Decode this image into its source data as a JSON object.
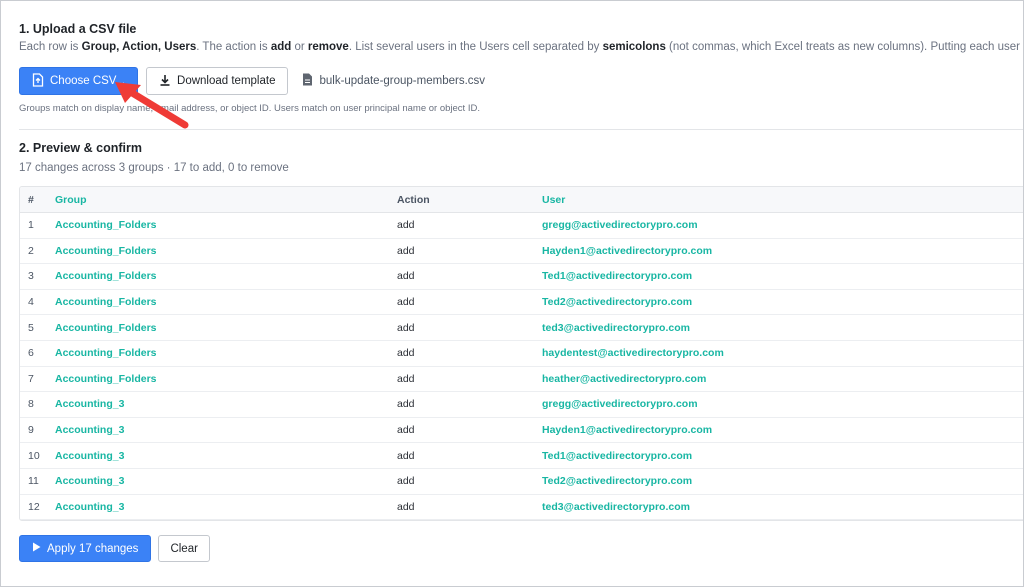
{
  "upload": {
    "title": "1. Upload a CSV file",
    "desc_parts": [
      "Each row is ",
      "Group, Action, Users",
      ". The action is ",
      "add",
      " or ",
      "remove",
      ". List several users in the Users cell separated by ",
      "semicolons",
      " (not commas, which Excel treats as new columns). Putting each user in its own c"
    ],
    "choose_label": "Choose CSV...",
    "template_label": "Download template",
    "file_name": "bulk-update-group-members.csv",
    "hint": "Groups match on display name, email address, or object ID. Users match on user principal name or object ID."
  },
  "preview": {
    "title": "2. Preview & confirm",
    "summary": "17 changes across 3 groups · 17 to add, 0 to remove",
    "columns": [
      "#",
      "Group",
      "Action",
      "User"
    ],
    "rows": [
      {
        "num": "1",
        "group": "Accounting_Folders",
        "action": "add",
        "user": "gregg@activedirectorypro.com"
      },
      {
        "num": "2",
        "group": "Accounting_Folders",
        "action": "add",
        "user": "Hayden1@activedirectorypro.com"
      },
      {
        "num": "3",
        "group": "Accounting_Folders",
        "action": "add",
        "user": "Ted1@activedirectorypro.com"
      },
      {
        "num": "4",
        "group": "Accounting_Folders",
        "action": "add",
        "user": "Ted2@activedirectorypro.com"
      },
      {
        "num": "5",
        "group": "Accounting_Folders",
        "action": "add",
        "user": "ted3@activedirectorypro.com"
      },
      {
        "num": "6",
        "group": "Accounting_Folders",
        "action": "add",
        "user": "haydentest@activedirectorypro.com"
      },
      {
        "num": "7",
        "group": "Accounting_Folders",
        "action": "add",
        "user": "heather@activedirectorypro.com"
      },
      {
        "num": "8",
        "group": "Accounting_3",
        "action": "add",
        "user": "gregg@activedirectorypro.com"
      },
      {
        "num": "9",
        "group": "Accounting_3",
        "action": "add",
        "user": "Hayden1@activedirectorypro.com"
      },
      {
        "num": "10",
        "group": "Accounting_3",
        "action": "add",
        "user": "Ted1@activedirectorypro.com"
      },
      {
        "num": "11",
        "group": "Accounting_3",
        "action": "add",
        "user": "Ted2@activedirectorypro.com"
      },
      {
        "num": "12",
        "group": "Accounting_3",
        "action": "add",
        "user": "ted3@activedirectorypro.com"
      }
    ]
  },
  "actions": {
    "apply_label": "Apply 17 changes",
    "clear_label": "Clear"
  },
  "colors": {
    "accent": "#3b82f6",
    "link": "#18b6a3",
    "annotation_arrow": "#ef3b36"
  }
}
